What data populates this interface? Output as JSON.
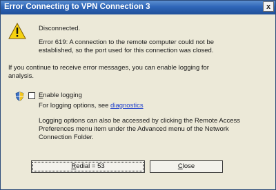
{
  "window": {
    "title": "Error Connecting to VPN Connection 3",
    "close_glyph": "x"
  },
  "message": {
    "status": "Disconnected.",
    "error_line1": "Error 619: A connection to the remote computer could not be",
    "error_line2": "established, so the port used for this connection was closed.",
    "info_line1": "If you continue to receive error messages, you can enable logging for",
    "info_line2": "analysis."
  },
  "logging": {
    "checkbox_mnemonic": "E",
    "checkbox_label_rest": "nable logging",
    "checked": false,
    "options_prefix": "For logging options, see ",
    "diagnostics_link": "diagnostics",
    "access_line1": "Logging options can also be accessed by clicking the Remote Access",
    "access_line2": "Preferences menu item under the Advanced menu of the Network",
    "access_line3": "Connection Folder."
  },
  "buttons": {
    "redial_mnemonic": "R",
    "redial_rest": "edial = 53",
    "close_mnemonic": "C",
    "close_rest": "lose"
  },
  "icons": {
    "warning": "warning-icon",
    "shield": "shield-icon"
  },
  "colors": {
    "titlebar": "#2f66b8",
    "link": "#1e3fcc",
    "dialog_bg": "#ece9d8"
  }
}
